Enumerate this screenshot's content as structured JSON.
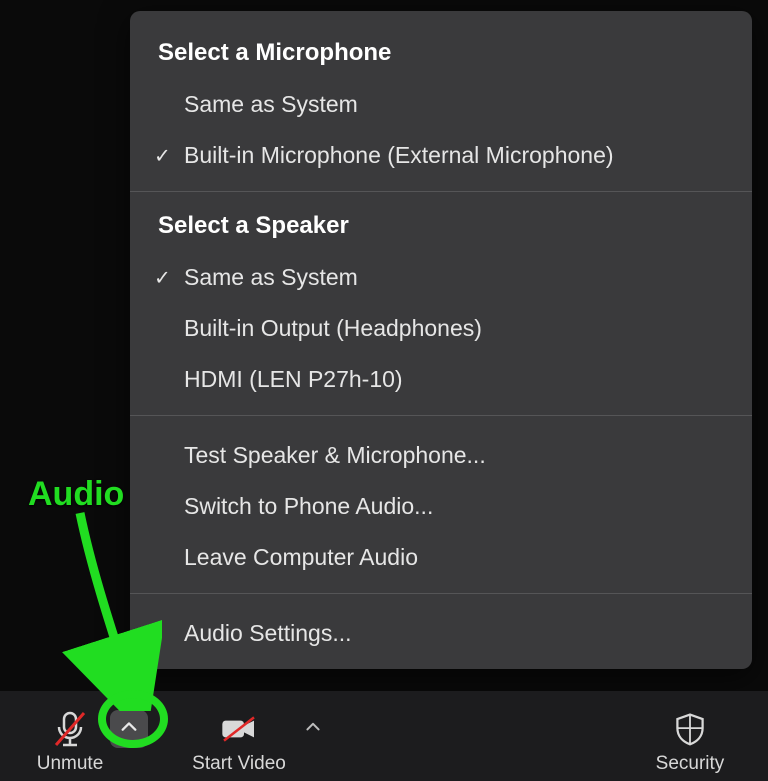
{
  "menu": {
    "mic_header": "Select a Microphone",
    "mic_items": [
      {
        "label": "Same as System",
        "checked": false
      },
      {
        "label": "Built-in Microphone (External Microphone)",
        "checked": true
      }
    ],
    "speaker_header": "Select a Speaker",
    "speaker_items": [
      {
        "label": "Same as System",
        "checked": true
      },
      {
        "label": "Built-in Output (Headphones)",
        "checked": false
      },
      {
        "label": "HDMI (LEN P27h-10)",
        "checked": false
      }
    ],
    "actions": [
      "Test Speaker & Microphone...",
      "Switch to Phone Audio...",
      "Leave Computer Audio"
    ],
    "settings": "Audio Settings..."
  },
  "toolbar": {
    "unmute": "Unmute",
    "start_video": "Start Video",
    "security": "Security"
  },
  "annotation": {
    "label": "Audio"
  },
  "glyphs": {
    "check": "✓"
  }
}
